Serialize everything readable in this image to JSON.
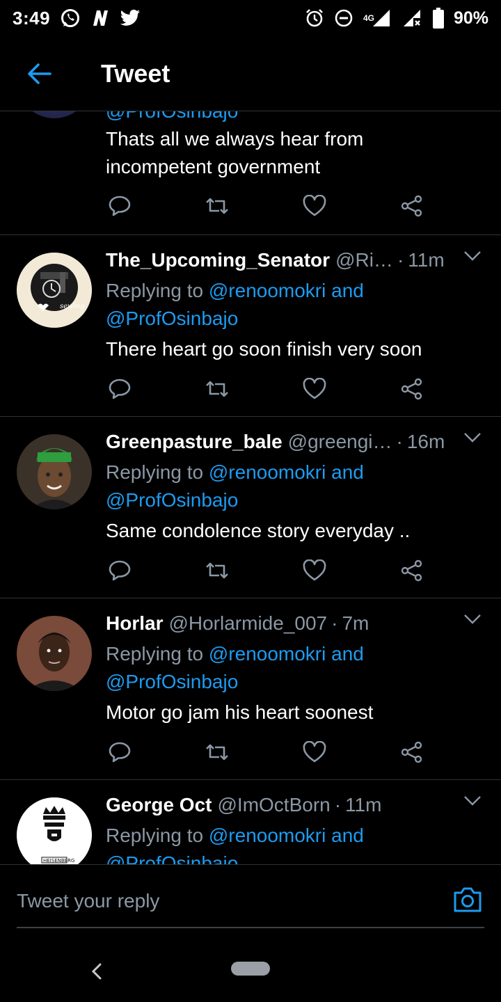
{
  "status_bar": {
    "time": "3:49",
    "network": "4G",
    "battery": "90%"
  },
  "header": {
    "title": "Tweet"
  },
  "top_tweet": {
    "partial_text": "@ProfOsinbajo",
    "text_line1": "Thats all we always hear from",
    "text_line2": "incompetent government"
  },
  "replies": [
    {
      "name": "The_Upcoming_Senator",
      "handle": "@Ri…",
      "time": "11m",
      "replying_prefix": "Replying to",
      "mention1": "@renoomokri",
      "and": "and",
      "mention2": "@ProfOsinbajo",
      "text": "There heart go soon finish very soon"
    },
    {
      "name": "Greenpasture_bale",
      "handle": "@greengi…",
      "time": "16m",
      "replying_prefix": "Replying to",
      "mention1": "@renoomokri",
      "and": "and",
      "mention2": "@ProfOsinbajo",
      "text": "Same condolence story everyday .."
    },
    {
      "name": "Horlar",
      "handle": "@Horlarmide_007",
      "time": "7m",
      "replying_prefix": "Replying to",
      "mention1": "@renoomokri",
      "and": "and",
      "mention2": "@ProfOsinbajo",
      "text": "Motor go jam his heart soonest"
    },
    {
      "name": "George Oct",
      "handle": "@ImOctBorn",
      "time": "11m",
      "replying_prefix": "Replying to",
      "mention1": "@renoomokri",
      "and": "and",
      "mention2": "@ProfOsinbajo"
    }
  ],
  "avatar_labels": {
    "senator": "sewing",
    "george": "HEISENBERG"
  },
  "reply_bar": {
    "placeholder": "Tweet your reply"
  },
  "colors": {
    "background": "#000000",
    "accent": "#1d9bf0",
    "secondary_text": "#8b98a5",
    "divider": "#2f3336"
  }
}
